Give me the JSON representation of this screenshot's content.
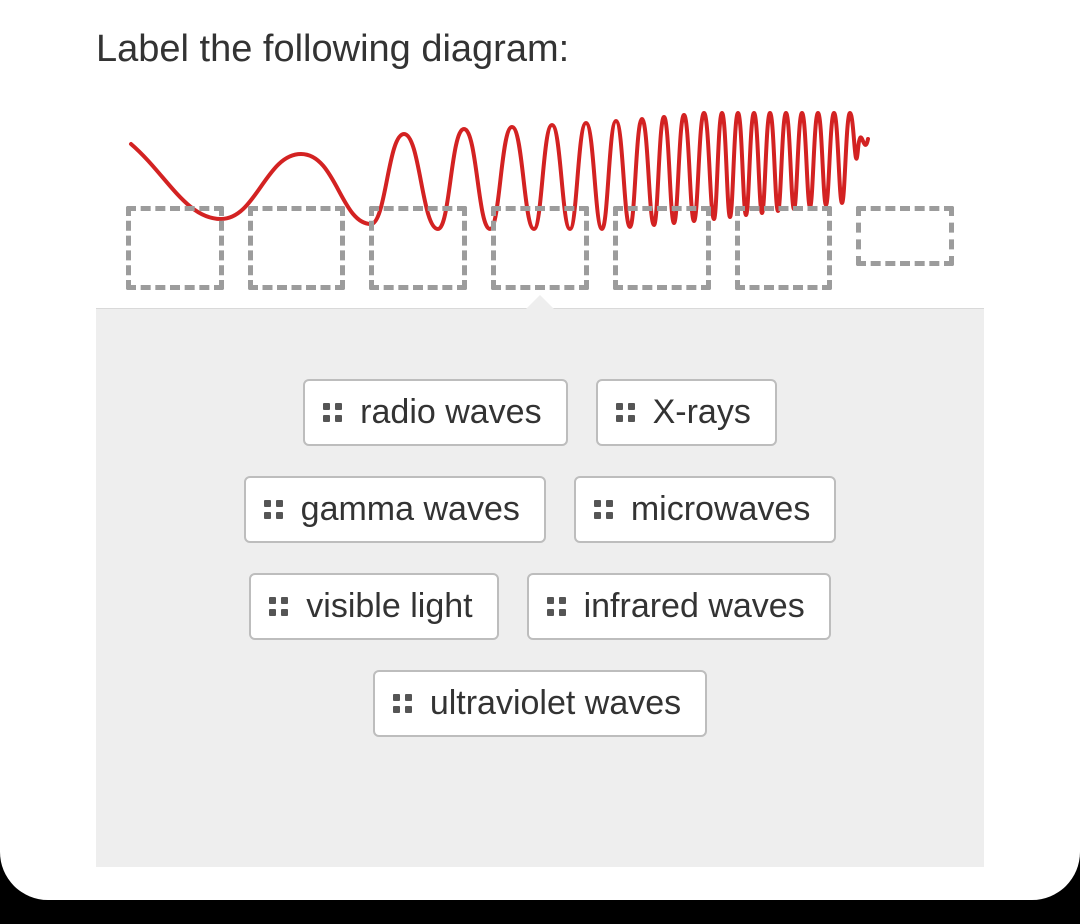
{
  "prompt": "Label the following diagram:",
  "dropzones": [
    {
      "id": "dz-1"
    },
    {
      "id": "dz-2"
    },
    {
      "id": "dz-3"
    },
    {
      "id": "dz-4"
    },
    {
      "id": "dz-5"
    },
    {
      "id": "dz-6"
    },
    {
      "id": "dz-7"
    }
  ],
  "chips": {
    "row1": [
      {
        "label": "radio waves",
        "name": "chip-radio-waves"
      },
      {
        "label": "X-rays",
        "name": "chip-x-rays"
      }
    ],
    "row2": [
      {
        "label": "gamma waves",
        "name": "chip-gamma-waves"
      },
      {
        "label": "microwaves",
        "name": "chip-microwaves"
      }
    ],
    "row3": [
      {
        "label": "visible light",
        "name": "chip-visible-light"
      },
      {
        "label": "infrared waves",
        "name": "chip-infrared-waves"
      }
    ],
    "row4": [
      {
        "label": "ultraviolet waves",
        "name": "chip-ultraviolet-waves"
      }
    ]
  }
}
